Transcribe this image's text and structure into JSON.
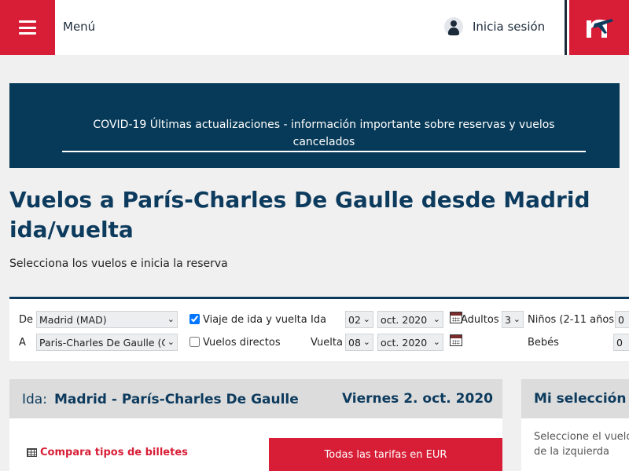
{
  "header": {
    "menu_label": "Menú",
    "login_label": "Inicia sesión",
    "menu_icon": "hamburger-icon",
    "user_icon": "user-icon",
    "logo_icon": "airline-logo",
    "brand_color": "#d81e36",
    "navy_color": "#0d3b5e"
  },
  "banner": {
    "text": "COVID-19 Últimas actualizaciones - información importante sobre reservas y vuelos cancelados"
  },
  "page": {
    "title": "Vuelos a París-Charles De Gaulle desde Madrid ida/vuelta",
    "subtitle": "Selecciona los vuelos e inicia la reserva"
  },
  "search": {
    "from_label": "De",
    "from_value": "Madrid (MAD)",
    "to_label": "A",
    "to_value": "Paris-Charles De Gaulle (C",
    "roundtrip_label": "Viaje de ida y vuelta",
    "roundtrip_checked": true,
    "direct_label": "Vuelos directos",
    "direct_checked": false,
    "outbound_label": "Ida",
    "outbound_day": "02",
    "outbound_month": "oct. 2020",
    "return_label": "Vuelta",
    "return_day": "08",
    "return_month": "oct. 2020",
    "adults_label": "Adultos",
    "adults_value": "3",
    "children_label": "Niños (2-11 años)",
    "children_value": "0",
    "infants_label": "Bebés",
    "infants_value": "0"
  },
  "outbound": {
    "ida_label": "Ida:",
    "route": "Madrid - París-Charles De Gaulle",
    "date": "Viernes 2. oct. 2020",
    "compare_label": "Compara tipos de billetes",
    "all_fares_label": "Todas las tarifas en EUR"
  },
  "selection": {
    "title": "Mi selección de vuelos",
    "body": "Seleccione el vuelo de la lista de la izquierda"
  }
}
